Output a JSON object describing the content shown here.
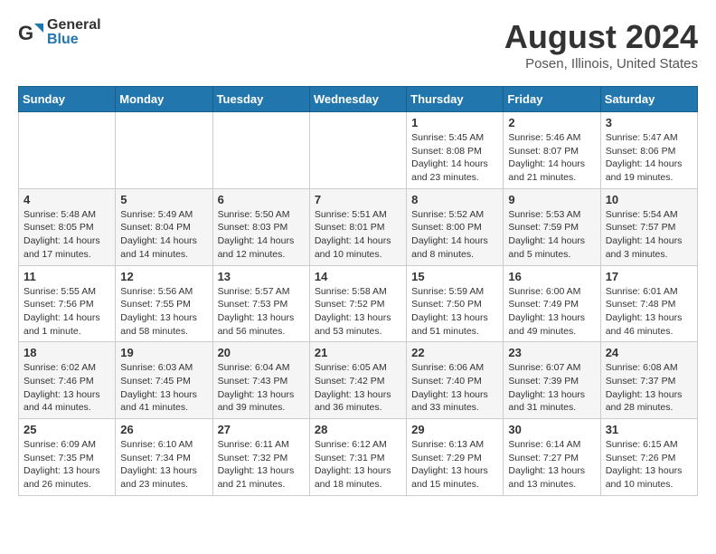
{
  "header": {
    "logo_general": "General",
    "logo_blue": "Blue",
    "title": "August 2024",
    "subtitle": "Posen, Illinois, United States"
  },
  "days_of_week": [
    "Sunday",
    "Monday",
    "Tuesday",
    "Wednesday",
    "Thursday",
    "Friday",
    "Saturday"
  ],
  "weeks": [
    [
      {
        "day": "",
        "info": ""
      },
      {
        "day": "",
        "info": ""
      },
      {
        "day": "",
        "info": ""
      },
      {
        "day": "",
        "info": ""
      },
      {
        "day": "1",
        "info": "Sunrise: 5:45 AM\nSunset: 8:08 PM\nDaylight: 14 hours\nand 23 minutes."
      },
      {
        "day": "2",
        "info": "Sunrise: 5:46 AM\nSunset: 8:07 PM\nDaylight: 14 hours\nand 21 minutes."
      },
      {
        "day": "3",
        "info": "Sunrise: 5:47 AM\nSunset: 8:06 PM\nDaylight: 14 hours\nand 19 minutes."
      }
    ],
    [
      {
        "day": "4",
        "info": "Sunrise: 5:48 AM\nSunset: 8:05 PM\nDaylight: 14 hours\nand 17 minutes."
      },
      {
        "day": "5",
        "info": "Sunrise: 5:49 AM\nSunset: 8:04 PM\nDaylight: 14 hours\nand 14 minutes."
      },
      {
        "day": "6",
        "info": "Sunrise: 5:50 AM\nSunset: 8:03 PM\nDaylight: 14 hours\nand 12 minutes."
      },
      {
        "day": "7",
        "info": "Sunrise: 5:51 AM\nSunset: 8:01 PM\nDaylight: 14 hours\nand 10 minutes."
      },
      {
        "day": "8",
        "info": "Sunrise: 5:52 AM\nSunset: 8:00 PM\nDaylight: 14 hours\nand 8 minutes."
      },
      {
        "day": "9",
        "info": "Sunrise: 5:53 AM\nSunset: 7:59 PM\nDaylight: 14 hours\nand 5 minutes."
      },
      {
        "day": "10",
        "info": "Sunrise: 5:54 AM\nSunset: 7:57 PM\nDaylight: 14 hours\nand 3 minutes."
      }
    ],
    [
      {
        "day": "11",
        "info": "Sunrise: 5:55 AM\nSunset: 7:56 PM\nDaylight: 14 hours\nand 1 minute."
      },
      {
        "day": "12",
        "info": "Sunrise: 5:56 AM\nSunset: 7:55 PM\nDaylight: 13 hours\nand 58 minutes."
      },
      {
        "day": "13",
        "info": "Sunrise: 5:57 AM\nSunset: 7:53 PM\nDaylight: 13 hours\nand 56 minutes."
      },
      {
        "day": "14",
        "info": "Sunrise: 5:58 AM\nSunset: 7:52 PM\nDaylight: 13 hours\nand 53 minutes."
      },
      {
        "day": "15",
        "info": "Sunrise: 5:59 AM\nSunset: 7:50 PM\nDaylight: 13 hours\nand 51 minutes."
      },
      {
        "day": "16",
        "info": "Sunrise: 6:00 AM\nSunset: 7:49 PM\nDaylight: 13 hours\nand 49 minutes."
      },
      {
        "day": "17",
        "info": "Sunrise: 6:01 AM\nSunset: 7:48 PM\nDaylight: 13 hours\nand 46 minutes."
      }
    ],
    [
      {
        "day": "18",
        "info": "Sunrise: 6:02 AM\nSunset: 7:46 PM\nDaylight: 13 hours\nand 44 minutes."
      },
      {
        "day": "19",
        "info": "Sunrise: 6:03 AM\nSunset: 7:45 PM\nDaylight: 13 hours\nand 41 minutes."
      },
      {
        "day": "20",
        "info": "Sunrise: 6:04 AM\nSunset: 7:43 PM\nDaylight: 13 hours\nand 39 minutes."
      },
      {
        "day": "21",
        "info": "Sunrise: 6:05 AM\nSunset: 7:42 PM\nDaylight: 13 hours\nand 36 minutes."
      },
      {
        "day": "22",
        "info": "Sunrise: 6:06 AM\nSunset: 7:40 PM\nDaylight: 13 hours\nand 33 minutes."
      },
      {
        "day": "23",
        "info": "Sunrise: 6:07 AM\nSunset: 7:39 PM\nDaylight: 13 hours\nand 31 minutes."
      },
      {
        "day": "24",
        "info": "Sunrise: 6:08 AM\nSunset: 7:37 PM\nDaylight: 13 hours\nand 28 minutes."
      }
    ],
    [
      {
        "day": "25",
        "info": "Sunrise: 6:09 AM\nSunset: 7:35 PM\nDaylight: 13 hours\nand 26 minutes."
      },
      {
        "day": "26",
        "info": "Sunrise: 6:10 AM\nSunset: 7:34 PM\nDaylight: 13 hours\nand 23 minutes."
      },
      {
        "day": "27",
        "info": "Sunrise: 6:11 AM\nSunset: 7:32 PM\nDaylight: 13 hours\nand 21 minutes."
      },
      {
        "day": "28",
        "info": "Sunrise: 6:12 AM\nSunset: 7:31 PM\nDaylight: 13 hours\nand 18 minutes."
      },
      {
        "day": "29",
        "info": "Sunrise: 6:13 AM\nSunset: 7:29 PM\nDaylight: 13 hours\nand 15 minutes."
      },
      {
        "day": "30",
        "info": "Sunrise: 6:14 AM\nSunset: 7:27 PM\nDaylight: 13 hours\nand 13 minutes."
      },
      {
        "day": "31",
        "info": "Sunrise: 6:15 AM\nSunset: 7:26 PM\nDaylight: 13 hours\nand 10 minutes."
      }
    ]
  ]
}
